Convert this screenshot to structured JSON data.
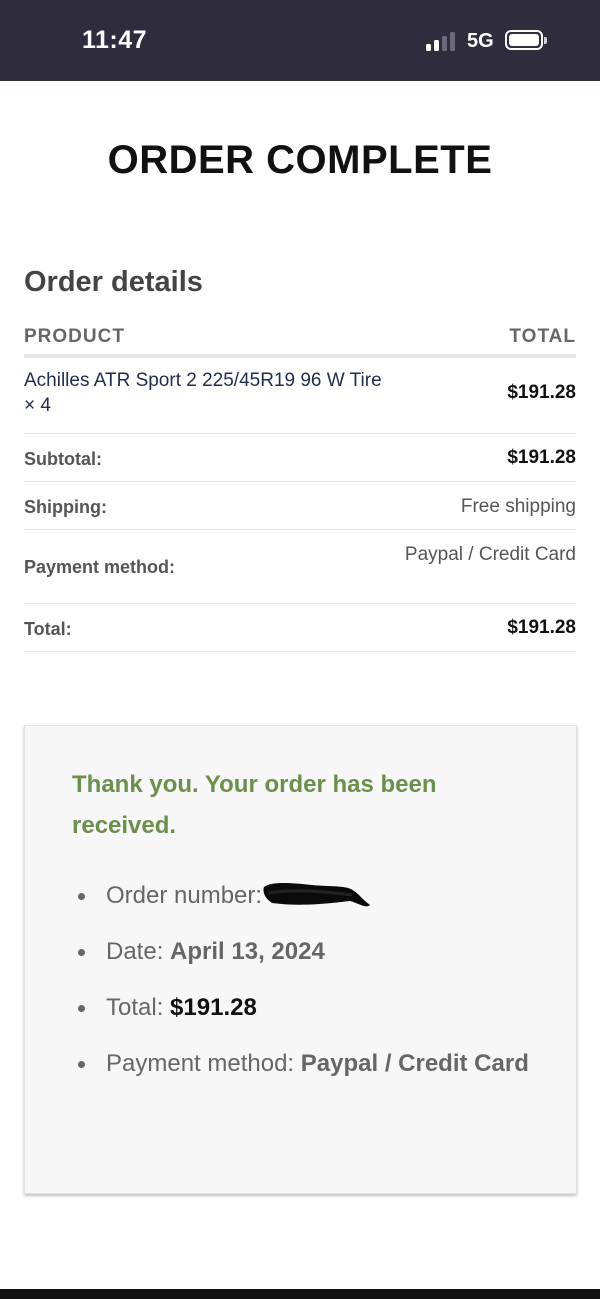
{
  "status_bar": {
    "time": "11:47",
    "network": "5G",
    "icons": [
      "signal-icon",
      "battery-icon"
    ]
  },
  "page": {
    "title": "ORDER COMPLETE"
  },
  "order_details": {
    "title": "Order details",
    "headers": {
      "product": "PRODUCT",
      "total": "TOTAL"
    },
    "product": {
      "name": "Achilles ATR Sport 2 225/45R19 96 W Tire × 4",
      "total": "$191.28"
    },
    "subtotal": {
      "label": "Subtotal:",
      "value": "$191.28"
    },
    "shipping": {
      "label": "Shipping:",
      "value": "Free shipping"
    },
    "payment": {
      "label": "Payment method:",
      "value": "Paypal / Credit Card"
    },
    "total": {
      "label": "Total:",
      "value": "$191.28"
    }
  },
  "thank_you": {
    "message": "Thank you. Your order has been received.",
    "order_number_label": "Order number:",
    "date_label": "Date:",
    "date_value": "April 13, 2024",
    "total_label": "Total:",
    "total_value": "$191.28",
    "payment_label": "Payment method:",
    "payment_value": "Paypal / Credit Card"
  },
  "colors": {
    "status_bar_bg": "#2e2c3d",
    "success_green": "#6b8f4c",
    "box_bg": "#f7f7f7"
  }
}
